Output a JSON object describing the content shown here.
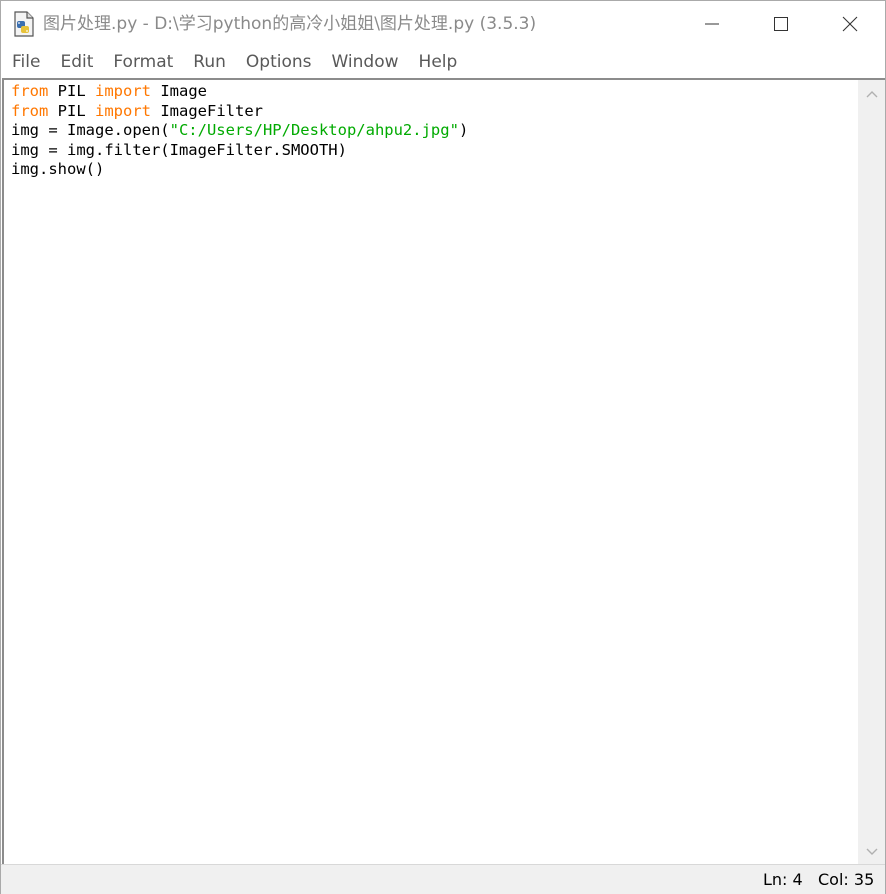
{
  "window": {
    "title": "图片处理.py - D:\\学习python的高冷小姐姐\\图片处理.py (3.5.3)",
    "icons": {
      "app": "python-file-icon",
      "minimize": "minimize-icon",
      "maximize": "maximize-icon",
      "close": "close-icon"
    }
  },
  "menu": {
    "items": [
      "File",
      "Edit",
      "Format",
      "Run",
      "Options",
      "Window",
      "Help"
    ]
  },
  "editor": {
    "lines": [
      [
        {
          "t": "from",
          "c": "kw"
        },
        {
          "t": " PIL ",
          "c": ""
        },
        {
          "t": "import",
          "c": "kw"
        },
        {
          "t": " Image",
          "c": ""
        }
      ],
      [
        {
          "t": "from",
          "c": "kw"
        },
        {
          "t": " PIL ",
          "c": ""
        },
        {
          "t": "import",
          "c": "kw"
        },
        {
          "t": " ImageFilter",
          "c": ""
        }
      ],
      [
        {
          "t": "img = Image.open(",
          "c": ""
        },
        {
          "t": "\"C:/Users/HP/Desktop/ahpu2.jpg\"",
          "c": "str"
        },
        {
          "t": ")",
          "c": ""
        }
      ],
      [
        {
          "t": "img = img.filter(ImageFilter.SMOOTH)",
          "c": ""
        }
      ],
      [
        {
          "t": "img.show()",
          "c": ""
        }
      ]
    ],
    "colors": {
      "keyword": "#ff7700",
      "string": "#00aa00",
      "default": "#000000"
    }
  },
  "status": {
    "line": "Ln: 4",
    "column": "Col: 35"
  },
  "scrollbar": {
    "up_icon": "chevron-up-icon",
    "down_icon": "chevron-down-icon"
  }
}
